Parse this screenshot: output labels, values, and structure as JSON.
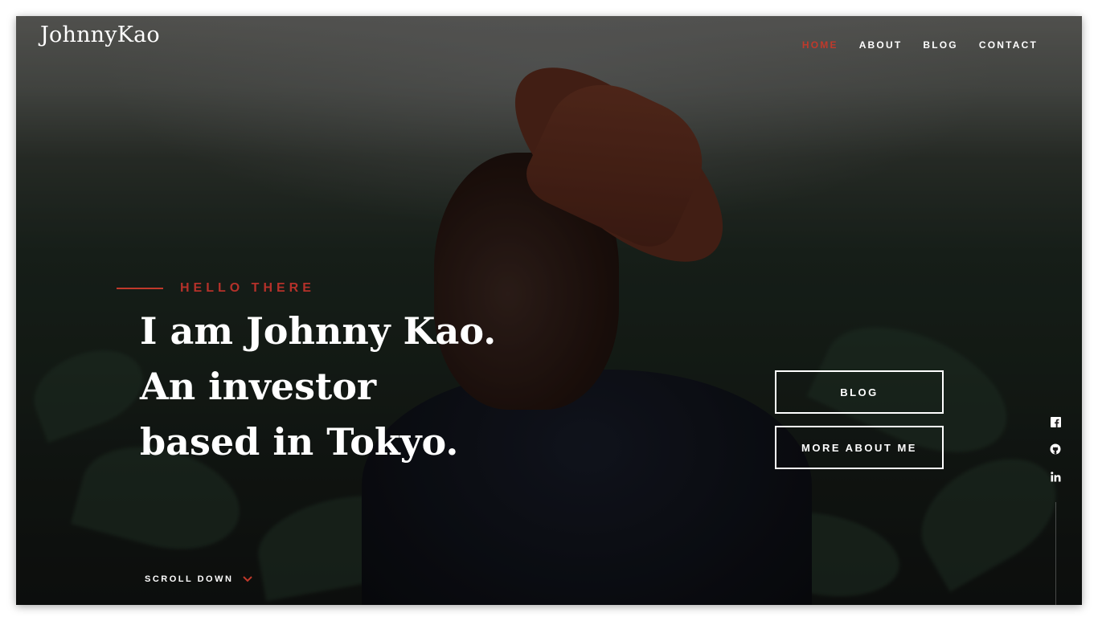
{
  "brand": {
    "logo": "JohnnyKao"
  },
  "nav": {
    "items": [
      {
        "label": "HOME",
        "active": true
      },
      {
        "label": "ABOUT",
        "active": false
      },
      {
        "label": "BLOG",
        "active": false
      },
      {
        "label": "CONTACT",
        "active": false
      }
    ]
  },
  "hero": {
    "kicker": "HELLO THERE",
    "headline": [
      "I am Johnny Kao.",
      "An investor",
      "based in Tokyo."
    ],
    "buttons": {
      "blog": "BLOG",
      "more": "MORE ABOUT ME"
    },
    "scroll_label": "SCROLL DOWN"
  },
  "social": {
    "icons": [
      "facebook-icon",
      "github-icon",
      "linkedin-icon"
    ]
  },
  "colors": {
    "accent": "#c0392b",
    "text": "#ffffff",
    "overlay": "#1a231c"
  }
}
